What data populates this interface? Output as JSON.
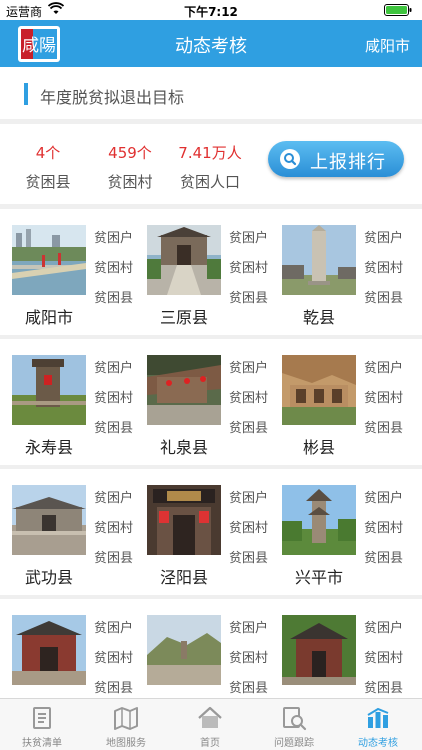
{
  "status_bar": {
    "carrier": "运营商",
    "time": "下午7:12"
  },
  "navbar": {
    "logo_text": "咸陽",
    "title": "动态考核",
    "city": "咸阳市"
  },
  "section": {
    "title": "年度脱贫拟退出目标"
  },
  "stats": [
    {
      "value": "4个",
      "label": "贫困县"
    },
    {
      "value": "459个",
      "label": "贫困村"
    },
    {
      "value": "7.41万人",
      "label": "贫困人口"
    }
  ],
  "report_button": {
    "label": "上报排行",
    "icon": "search-icon"
  },
  "tags": [
    "贫困户",
    "贫困村",
    "贫困县"
  ],
  "areas": [
    {
      "name": "咸阳市"
    },
    {
      "name": "三原县"
    },
    {
      "name": "乾县"
    },
    {
      "name": "永寿县"
    },
    {
      "name": "礼泉县"
    },
    {
      "name": "彬县"
    },
    {
      "name": "武功县"
    },
    {
      "name": "泾阳县"
    },
    {
      "name": "兴平市"
    },
    {
      "name": ""
    },
    {
      "name": ""
    },
    {
      "name": ""
    }
  ],
  "tabs": [
    {
      "label": "扶贫清单",
      "icon": "document-list-icon",
      "active": false
    },
    {
      "label": "地图服务",
      "icon": "map-icon",
      "active": false
    },
    {
      "label": "首页",
      "icon": "home-icon",
      "active": false
    },
    {
      "label": "问题跟踪",
      "icon": "search-document-icon",
      "active": false
    },
    {
      "label": "动态考核",
      "icon": "chart-icon",
      "active": true
    }
  ],
  "colors": {
    "accent": "#2f9fe1",
    "stat_value": "#e03030"
  }
}
